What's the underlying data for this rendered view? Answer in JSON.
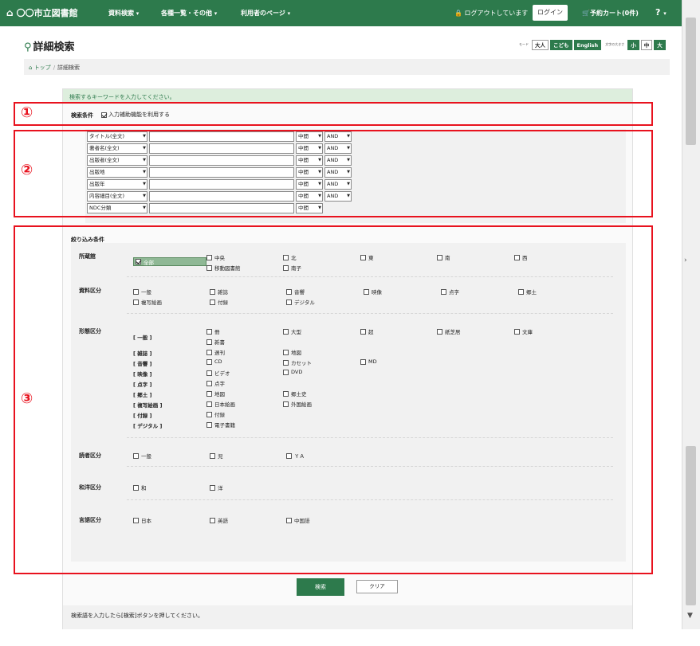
{
  "topbar": {
    "brand": "〇〇市立図書館",
    "nav": [
      "資料検索",
      "各種一覧・その他",
      "利用者のページ"
    ],
    "logout": "ログアウトしています",
    "login": "ログイン",
    "cart": "予約カート(0件)",
    "help": "?"
  },
  "page": {
    "title": "詳細検索",
    "modes_tiny": "モード",
    "modes": [
      "大人",
      "こども",
      "English"
    ],
    "text_size_tiny": "文字の大きさ",
    "text_sizes": [
      "小",
      "中",
      "大"
    ]
  },
  "breadcrumb": {
    "home": "トップ",
    "current": "詳細検索"
  },
  "search": {
    "message": "検索するキーワードを入力してください。",
    "condition_label": "検索条件",
    "assist_label": "入力補助機能を利用する",
    "rows": [
      {
        "field": "タイトル(全文)",
        "match": "中間",
        "op": "AND"
      },
      {
        "field": "著者名(全文)",
        "match": "中間",
        "op": "AND"
      },
      {
        "field": "出版者(全文)",
        "match": "中間",
        "op": "AND"
      },
      {
        "field": "出版地",
        "match": "中間",
        "op": "AND"
      },
      {
        "field": "出版年",
        "match": "中間",
        "op": "AND"
      },
      {
        "field": "内容細目(全文)",
        "match": "中間",
        "op": "AND"
      },
      {
        "field": "NDC分類",
        "match": "中間",
        "op": ""
      }
    ]
  },
  "filters": {
    "label": "絞り込み条件",
    "library": {
      "label": "所蔵館",
      "options": [
        "全部",
        "中央",
        "北",
        "東",
        "南",
        "西",
        "移動図書館",
        "南子"
      ]
    },
    "material": {
      "label": "資料区分",
      "options": [
        "一般",
        "雑誌",
        "音響",
        "映像",
        "点字",
        "郷土",
        "複写絵画",
        "付録",
        "デジタル"
      ]
    },
    "form": {
      "label": "形態区分",
      "general_label": "[ 一般 ]",
      "general": [
        "冊",
        "大型",
        "超",
        "紙芝居",
        "文庫",
        "新書"
      ],
      "groups": [
        {
          "label": "[ 雑誌 ]",
          "options": [
            "週刊",
            "地図"
          ]
        },
        {
          "label": "[ 音響 ]",
          "options": [
            "CD",
            "カセット",
            "MD"
          ]
        },
        {
          "label": "[ 映像 ]",
          "options": [
            "ビデオ",
            "DVD"
          ]
        },
        {
          "label": "[ 点字 ]",
          "options": [
            "点字"
          ]
        },
        {
          "label": "[ 郷土 ]",
          "options": [
            "地図",
            "郷土史"
          ]
        },
        {
          "label": "[ 複写絵画 ]",
          "options": [
            "日本絵画",
            "外国絵画"
          ]
        },
        {
          "label": "[ 付録 ]",
          "options": [
            "付録"
          ]
        },
        {
          "label": "[ デジタル ]",
          "options": [
            "電子書籍"
          ]
        }
      ]
    },
    "reader": {
      "label": "読者区分",
      "options": [
        "一般",
        "児",
        "ＹＡ"
      ]
    },
    "origin": {
      "label": "和洋区分",
      "options": [
        "和",
        "洋"
      ]
    },
    "language": {
      "label": "言語区分",
      "options": [
        "日本",
        "英語",
        "中国語"
      ]
    }
  },
  "actions": {
    "search": "検索",
    "clear": "クリア"
  },
  "footer_text": "検索語を入力したら[検索]ボタンを押してください。",
  "callouts": [
    "①",
    "②",
    "③"
  ],
  "colors": {
    "brand_green": "#2d7a4c",
    "annotation_red": "#e8121e"
  }
}
